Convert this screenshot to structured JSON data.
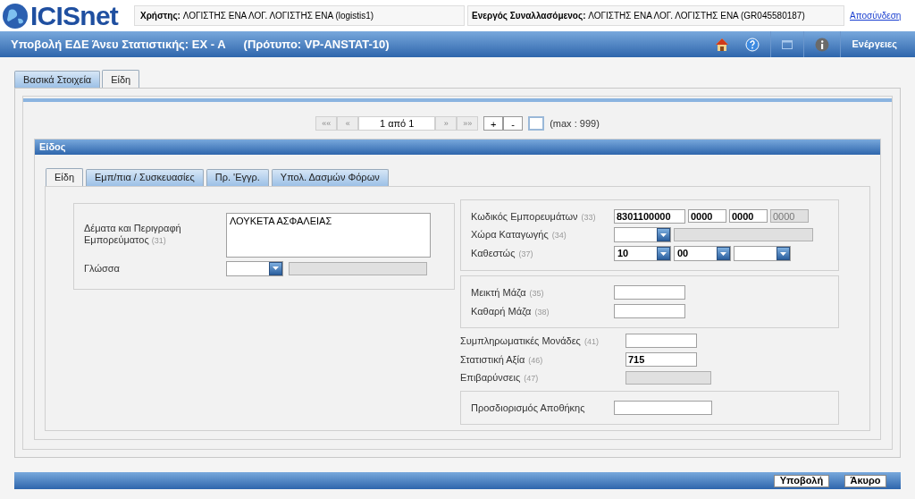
{
  "header": {
    "logo": "ICISnet",
    "user_label": "Χρήστης:",
    "user": "ΛΟΓΙΣΤΗΣ ΕΝΑ ΛΟΓ. ΛΟΓΙΣΤΗΣ ΕΝΑ (logistis1)",
    "trader_label": "Ενεργός Συναλλασόμενος:",
    "trader": "ΛΟΓΙΣΤΗΣ ΕΝΑ ΛΟΓ. ΛΟΓΙΣΤΗΣ ΕΝΑ (GR045580187)",
    "logout": "Αποσύνδεση"
  },
  "title_bar": {
    "title": "Υποβολή ΕΔΕ Άνευ Στατιστικής: EX - A",
    "template": "(Πρότυπο: VP-ANSTAT-10)",
    "actions": "Ενέργειες"
  },
  "tabs": [
    {
      "label": "Βασικά Στοιχεία",
      "selected": false
    },
    {
      "label": "Είδη",
      "selected": true
    }
  ],
  "pager": {
    "first": {
      "label": "««",
      "disabled": true
    },
    "prev": {
      "label": "«",
      "disabled": true
    },
    "page": "1 από 1",
    "next": {
      "label": "»",
      "disabled": true
    },
    "last": {
      "label": "»»",
      "disabled": true
    },
    "add": "+",
    "remove": "-",
    "max": "(max : 999)"
  },
  "section_title": "Είδος",
  "subtabs": [
    {
      "label": "Είδη",
      "selected": true
    },
    {
      "label": "Εμπ/πια / Συσκευασίες",
      "selected": false
    },
    {
      "label": "Πρ. 'Εγγρ.",
      "selected": false
    },
    {
      "label": "Υπολ. Δασμών Φόρων",
      "selected": false
    }
  ],
  "description": {
    "label": "Δέματα και Περιγραφή Εμπορεύματος",
    "code": "(31)",
    "value": "ΛΟΥΚΕΤΑ ΑΣΦΑΛΕΙΑΣ"
  },
  "language": {
    "label": "Γλώσσα",
    "inputs": [
      {
        "kind": "select"
      },
      {
        "kind": "readonly"
      }
    ]
  },
  "groups": [
    {
      "boxed": true,
      "rows": [
        {
          "label": "Κωδικός Εμπορευμάτων",
          "code": "(33)",
          "inputs": [
            {
              "kind": "input",
              "value": "8301100000"
            },
            {
              "kind": "short-input",
              "value": "0000"
            },
            {
              "kind": "short-input",
              "value": "0000"
            },
            {
              "kind": "readonly-short",
              "value": "0000"
            }
          ]
        },
        {
          "label": "Χώρα Καταγωγής",
          "code": "(34)",
          "inputs": [
            {
              "kind": "select"
            },
            {
              "kind": "readonly"
            }
          ]
        },
        {
          "label": "Καθεστώς",
          "code": "(37)",
          "inputs": [
            {
              "kind": "select",
              "value": "10"
            },
            {
              "kind": "select",
              "value": "00"
            },
            {
              "kind": "select"
            }
          ]
        }
      ]
    },
    {
      "boxed": true,
      "rows": [
        {
          "label": "Μεικτή Μάζα",
          "code": "(35)",
          "inputs": [
            {
              "kind": "input"
            }
          ]
        },
        {
          "label": "Καθαρή Μάζα",
          "code": "(38)",
          "inputs": [
            {
              "kind": "input"
            }
          ]
        }
      ]
    },
    {
      "boxed": false,
      "rows": [
        {
          "label": "Συμπληρωματικές Μονάδες",
          "code": "(41)",
          "inputs": [
            {
              "kind": "input"
            }
          ]
        },
        {
          "label": "Στατιστική Αξία",
          "code": "(46)",
          "inputs": [
            {
              "kind": "input",
              "value": "715"
            }
          ]
        },
        {
          "label": "Επιβαρύνσεις",
          "code": "(47)",
          "inputs": [
            {
              "kind": "readonly-input"
            }
          ]
        }
      ]
    },
    {
      "boxed": true,
      "rows": [
        {
          "label": "Προσδιορισμός Αποθήκης",
          "inputs": [
            {
              "kind": "wide-input"
            }
          ]
        }
      ]
    }
  ],
  "footer": {
    "submit": "Υποβολή",
    "cancel": "Άκυρο"
  }
}
